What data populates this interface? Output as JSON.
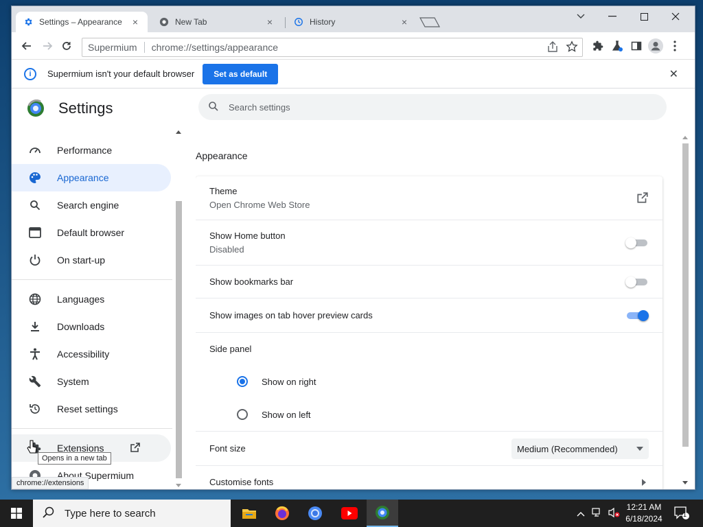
{
  "browser": {
    "tabs": [
      {
        "label": "Settings – Appearance",
        "icon": "gear-icon",
        "active": true
      },
      {
        "label": "New Tab",
        "icon": "chrome-icon",
        "active": false
      },
      {
        "label": "History",
        "icon": "history-icon",
        "active": false
      }
    ],
    "omnibox": {
      "site": "Supermium",
      "url": "chrome://settings/appearance"
    },
    "infobar": {
      "text": "Supermium isn't your default browser",
      "button": "Set as default"
    }
  },
  "settings": {
    "title": "Settings",
    "search_placeholder": "Search settings",
    "nav": [
      {
        "label": "Performance",
        "icon": "speedometer-icon"
      },
      {
        "label": "Appearance",
        "icon": "palette-icon",
        "active": true
      },
      {
        "label": "Search engine",
        "icon": "search-icon"
      },
      {
        "label": "Default browser",
        "icon": "browser-window-icon"
      },
      {
        "label": "On start-up",
        "icon": "power-icon"
      },
      {
        "label": "Languages",
        "icon": "globe-icon"
      },
      {
        "label": "Downloads",
        "icon": "download-icon"
      },
      {
        "label": "Accessibility",
        "icon": "accessibility-icon"
      },
      {
        "label": "System",
        "icon": "wrench-icon"
      },
      {
        "label": "Reset settings",
        "icon": "reset-icon"
      },
      {
        "label": "Extensions",
        "icon": "puzzle-icon"
      },
      {
        "label": "About Supermium",
        "icon": "supermium-logo-icon"
      }
    ],
    "tooltip": "Opens in a new tab",
    "status_url": "chrome://extensions",
    "appearance": {
      "section_title": "Appearance",
      "theme": {
        "label": "Theme",
        "sub": "Open Chrome Web Store"
      },
      "home_button": {
        "label": "Show Home button",
        "sub": "Disabled",
        "enabled": false
      },
      "bookmarks_bar": {
        "label": "Show bookmarks bar",
        "enabled": false
      },
      "hover_cards": {
        "label": "Show images on tab hover preview cards",
        "enabled": true
      },
      "side_panel": {
        "label": "Side panel",
        "options": [
          "Show on right",
          "Show on left"
        ],
        "selected": "Show on right"
      },
      "font_size": {
        "label": "Font size",
        "value": "Medium (Recommended)"
      },
      "customise_fonts": {
        "label": "Customise fonts"
      }
    }
  },
  "taskbar": {
    "search_placeholder": "Type here to search",
    "apps": [
      "file-explorer-icon",
      "firefox-icon",
      "chromium-icon",
      "youtube-icon",
      "supermium-icon"
    ],
    "time": "12:21 AM",
    "date": "6/18/2024",
    "notification_count": "1"
  },
  "colors": {
    "accent": "#1a73e8",
    "active_nav_bg": "#e8f0fe",
    "taskbar": "#1f1f1f"
  }
}
